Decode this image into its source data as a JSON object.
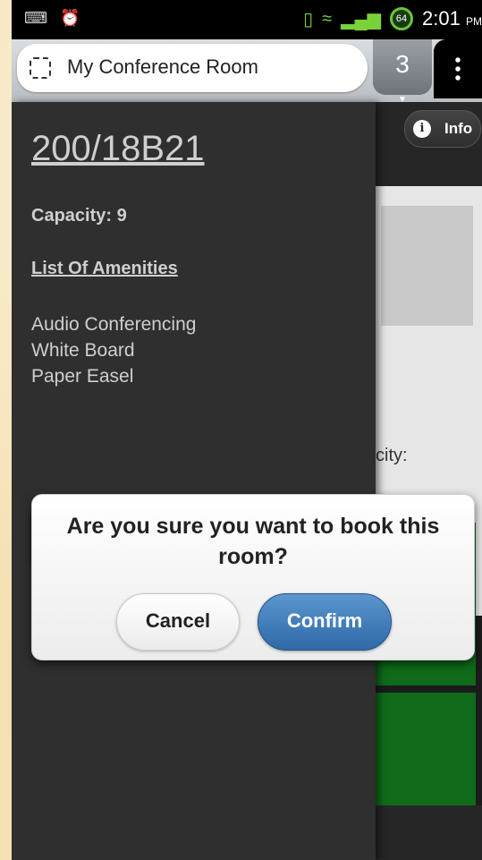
{
  "status_bar": {
    "battery_level": "64",
    "time": "2:01",
    "time_suffix": "PM"
  },
  "browser": {
    "page_title": "My Conference Room",
    "tab_count": "3"
  },
  "info_button": {
    "label": "Info"
  },
  "room": {
    "name": "200/18B21",
    "capacity": "Capacity: 9",
    "amenities_heading": "List Of Amenities",
    "amenities": [
      "Audio Conferencing",
      "White Board",
      "Paper Easel"
    ]
  },
  "right_pane": {
    "capacity_fragment": "city:"
  },
  "dialog": {
    "message": "Are you sure you want to book this room?",
    "cancel_label": "Cancel",
    "confirm_label": "Confirm",
    "confirm_color": "#3a76b6"
  },
  "colors": {
    "status_accent": "#6bc43a",
    "room_block": "#0f6b1a"
  }
}
